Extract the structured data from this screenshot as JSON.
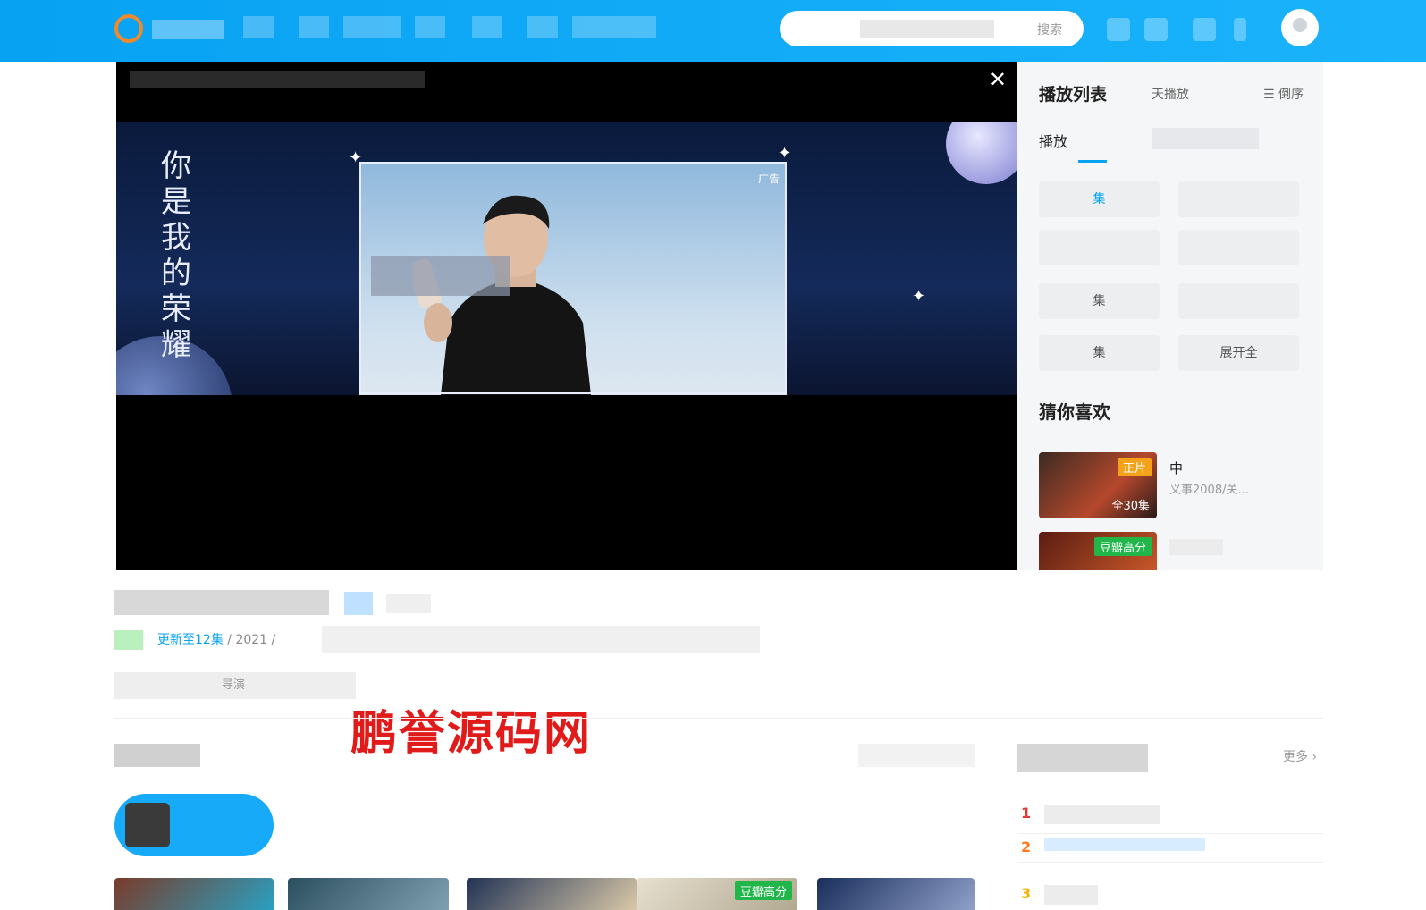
{
  "search": {
    "button": "搜索"
  },
  "player": {
    "close": "✕",
    "ad_tag": "广告",
    "ad_slogan": "你是我的荣耀"
  },
  "sidebar": {
    "title": "播放列表",
    "tab": "天播放",
    "sort": "倒序",
    "sub": "播放",
    "episodes": [
      "集",
      "",
      "",
      "",
      "集",
      "",
      "集",
      "展开全"
    ],
    "guess_title": "猜你喜欢",
    "recs": [
      {
        "badge": "正片",
        "badge_color": "#f3a21a",
        "count": "全30集",
        "title": "中",
        "sub": "义事2008/关..."
      },
      {
        "badge": "豆瓣高分",
        "badge_color": "#20b64a",
        "count": "",
        "title": "",
        "sub": ""
      }
    ]
  },
  "info": {
    "update": "更新至12集",
    "year": "/ 2021 /",
    "label": "导演"
  },
  "watermark": "鹏誉源码网",
  "posters": [
    {
      "badge": ""
    },
    {
      "badge": ""
    },
    {
      "badge": ""
    },
    {
      "badge": "豆瓣高分",
      "badge_color": "#20b64a"
    },
    {
      "badge": ""
    }
  ],
  "rank": {
    "more": "更多 ›",
    "items": [
      {
        "num": "1",
        "color": "#e53935"
      },
      {
        "num": "2",
        "color": "#ff7a1a"
      },
      {
        "num": "3",
        "color": "#f5b300"
      }
    ]
  }
}
